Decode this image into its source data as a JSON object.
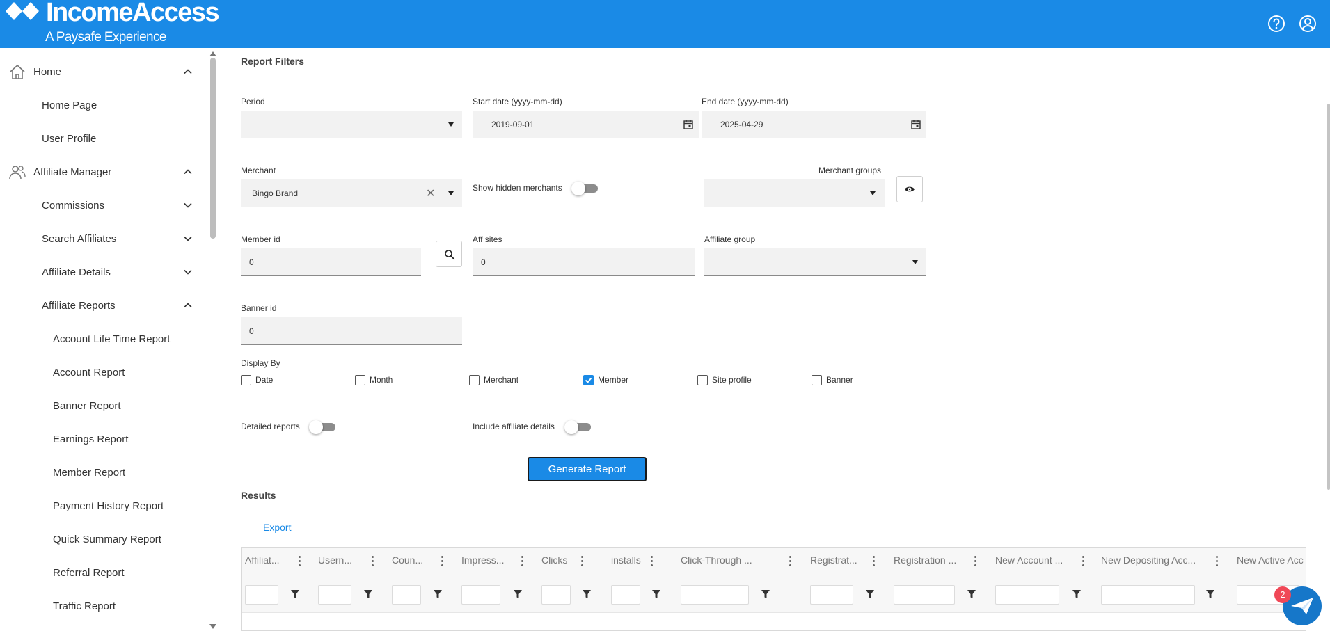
{
  "brand": {
    "title": "IncomeAccess",
    "subtitle": "A Paysafe Experience",
    "color": "#1a8ae6"
  },
  "header_icons": [
    "help-icon",
    "account-icon"
  ],
  "sidebar": {
    "items": [
      {
        "label": "Home",
        "level": 0,
        "icon": "home-icon",
        "chevron": "up"
      },
      {
        "label": "Home Page",
        "level": 1
      },
      {
        "label": "User Profile",
        "level": 1
      },
      {
        "label": "Affiliate Manager",
        "level": 0,
        "icon": "users-icon",
        "chevron": "up"
      },
      {
        "label": "Commissions",
        "level": 1,
        "chevron": "down"
      },
      {
        "label": "Search Affiliates",
        "level": 1,
        "chevron": "down"
      },
      {
        "label": "Affiliate Details",
        "level": 1,
        "chevron": "down"
      },
      {
        "label": "Affiliate Reports",
        "level": 1,
        "chevron": "up"
      },
      {
        "label": "Account Life Time Report",
        "level": 2
      },
      {
        "label": "Account Report",
        "level": 2
      },
      {
        "label": "Banner Report",
        "level": 2
      },
      {
        "label": "Earnings Report",
        "level": 2
      },
      {
        "label": "Member Report",
        "level": 2
      },
      {
        "label": "Payment History Report",
        "level": 2
      },
      {
        "label": "Quick Summary Report",
        "level": 2
      },
      {
        "label": "Referral Report",
        "level": 2
      },
      {
        "label": "Traffic Report",
        "level": 2
      }
    ]
  },
  "filters": {
    "title": "Report Filters",
    "period_label": "Period",
    "period_value": "",
    "start_label": "Start date (yyyy-mm-dd)",
    "start_value": "2019-09-01",
    "end_label": "End date (yyyy-mm-dd)",
    "end_value": "2025-04-29",
    "merchant_label": "Merchant",
    "merchant_value": "Bingo Brand",
    "show_hidden_label": "Show hidden merchants",
    "show_hidden_on": false,
    "merchant_groups_label": "Merchant groups",
    "merchant_groups_value": "",
    "member_id_label": "Member id",
    "member_id_value": "0",
    "aff_sites_label": "Aff sites",
    "aff_sites_value": "0",
    "affiliate_group_label": "Affiliate group",
    "affiliate_group_value": "",
    "banner_id_label": "Banner id",
    "banner_id_value": "0",
    "display_by_label": "Display By",
    "display_by": [
      {
        "label": "Date",
        "checked": false
      },
      {
        "label": "Month",
        "checked": false
      },
      {
        "label": "Merchant",
        "checked": false
      },
      {
        "label": "Member",
        "checked": true
      },
      {
        "label": "Site profile",
        "checked": false
      },
      {
        "label": "Banner",
        "checked": false
      }
    ],
    "detailed_label": "Detailed reports",
    "detailed_on": false,
    "include_aff_label": "Include affiliate details",
    "include_aff_on": false,
    "generate_label": "Generate Report"
  },
  "results": {
    "title": "Results",
    "export_label": "Export",
    "columns": [
      "Affiliat...",
      "Usern...",
      "Coun...",
      "Impress...",
      "Clicks",
      "installs",
      "Click-Through ...",
      "Registrat...",
      "Registration ...",
      "New Account ...",
      "New Depositing Acc...",
      "New Active Acc ..."
    ]
  },
  "chat": {
    "badge": "2"
  }
}
